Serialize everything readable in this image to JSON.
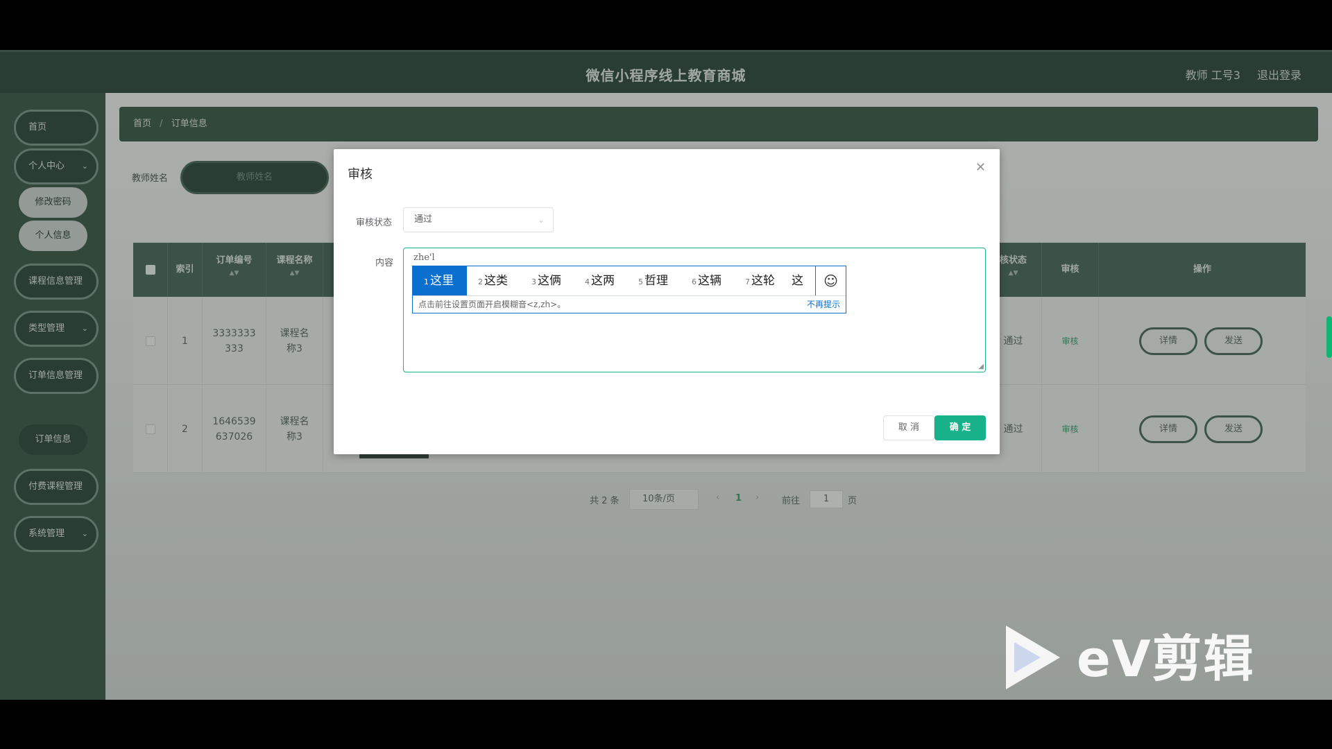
{
  "header": {
    "title": "微信小程序线上教育商城",
    "user": "教师 工号3",
    "logout": "退出登录"
  },
  "sidebar": {
    "home": "首页",
    "personal_center": "个人中心",
    "change_password": "修改密码",
    "personal_info": "个人信息",
    "course_info_mgmt": "课程信息管理",
    "type_mgmt": "类型管理",
    "order_info_mgmt": "订单信息管理",
    "order_info": "订单信息",
    "paid_course_mgmt": "付费课程管理",
    "system_mgmt": "系统管理",
    "chevron": "⌄"
  },
  "breadcrumb": {
    "home": "首页",
    "separator": "/",
    "current": "订单信息"
  },
  "search": {
    "label": "教师姓名",
    "placeholder": "教师姓名"
  },
  "table": {
    "headers": {
      "index": "索引",
      "order_no": "订单编号",
      "course_name": "课程名称",
      "audit_status": "核状态",
      "audit": "审核",
      "operation": "操作"
    },
    "rows": [
      {
        "index": "1",
        "order_no": "3333333333",
        "course_name": "课程名称3",
        "status": "通过",
        "audit": "审核",
        "detail": "详情",
        "send": "发送"
      },
      {
        "index": "2",
        "order_no": "1646539637026",
        "course_name": "课程名称3",
        "status": "通过",
        "audit": "审核",
        "detail": "详情",
        "send": "发送"
      }
    ]
  },
  "pager": {
    "total": "共 2 条",
    "page_size": "10条/页",
    "current": "1",
    "goto": "前往",
    "goto_value": "1",
    "page_suffix": "页"
  },
  "dialog": {
    "title": "审核",
    "status_label": "审核状态",
    "status_value": "通过",
    "content_label": "内容",
    "content_value": "zhe'l",
    "cancel": "取 消",
    "confirm": "确 定"
  },
  "ime": {
    "candidates": [
      {
        "n": "1",
        "w": "这里"
      },
      {
        "n": "2",
        "w": "这类"
      },
      {
        "n": "3",
        "w": "这俩"
      },
      {
        "n": "4",
        "w": "这两"
      },
      {
        "n": "5",
        "w": "哲理"
      },
      {
        "n": "6",
        "w": "这辆"
      },
      {
        "n": "7",
        "w": "这轮"
      }
    ],
    "partial": "这",
    "hint": "点击前往设置页面开启模糊音<z,zh>。",
    "dismiss": "不再提示"
  },
  "watermark": {
    "text": "eV剪辑"
  },
  "colors": {
    "header_bg": "#1f3a2b",
    "sidebar_bg": "#2d4a3a",
    "accent": "#17b18a",
    "ime_blue": "#0b6fcf"
  }
}
